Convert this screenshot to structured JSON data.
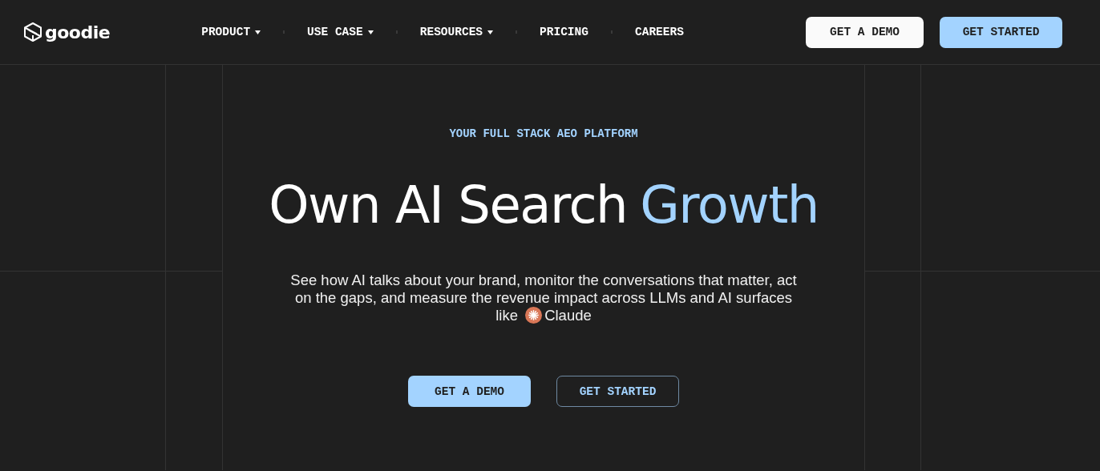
{
  "logo": {
    "text": "goodie"
  },
  "nav": [
    {
      "label": "PRODUCT",
      "dropdown": true
    },
    {
      "label": "USE CASE",
      "dropdown": true
    },
    {
      "label": "RESOURCES",
      "dropdown": true
    },
    {
      "label": "PRICING",
      "dropdown": false
    },
    {
      "label": "CAREERS",
      "dropdown": false
    }
  ],
  "header_buttons": [
    {
      "label": "GET A DEMO",
      "kind": "light"
    },
    {
      "label": "GET STARTED",
      "kind": "accent"
    }
  ],
  "hero": {
    "kicker": "YOUR FULL STACK AEO PLATFORM",
    "title": "Own AI Search",
    "title_accent": "Growth",
    "description": "See how AI talks about your brand, monitor the conversations that matter, act on the gaps, and measure the revenue impact across LLMs and AI surfaces like",
    "brand": "Claude",
    "buttons": [
      {
        "label": "GET A DEMO",
        "kind": "accent"
      },
      {
        "label": "GET STARTED",
        "kind": "outline"
      }
    ]
  }
}
